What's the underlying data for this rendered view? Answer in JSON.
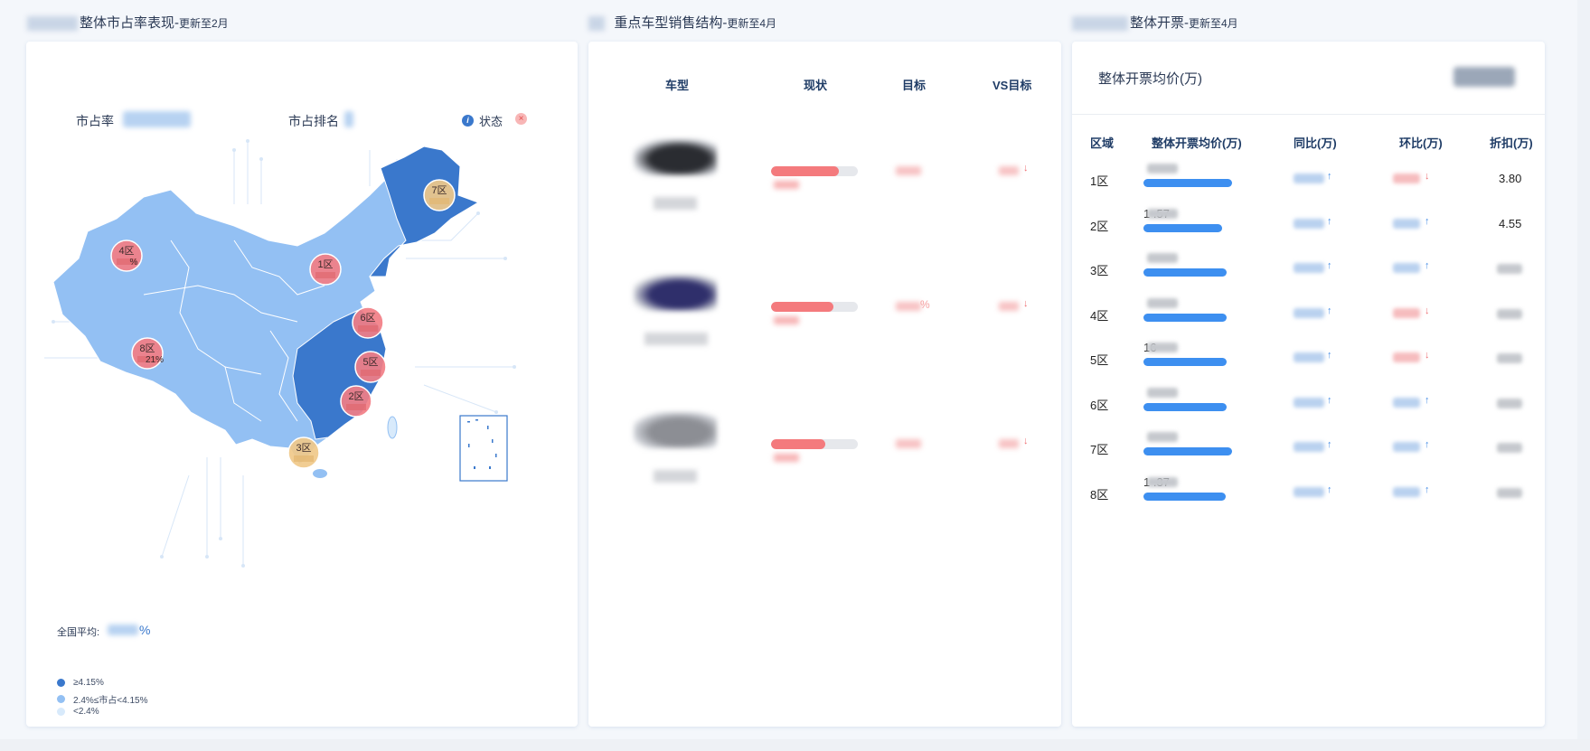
{
  "panels": {
    "map": {
      "title": "整体市占率表现-",
      "subtitle": "更新至2月"
    },
    "models": {
      "title": "重点车型销售结构-",
      "subtitle": "更新至4月"
    },
    "billing": {
      "title": "整体开票-",
      "subtitle": "更新至4月"
    }
  },
  "map": {
    "share_label": "市占率",
    "rank_label": "市占排名",
    "status_label": "状态",
    "national_avg_label": "全国平均:",
    "national_avg_suffix": "%",
    "regions": [
      {
        "name": "1区",
        "level": 0.4
      },
      {
        "name": "2区",
        "level": 0.4
      },
      {
        "name": "3区",
        "level": 0.6
      },
      {
        "name": "4区",
        "level": 0.4
      },
      {
        "name": "5区",
        "level": 0.4
      },
      {
        "name": "6区",
        "level": 0.4
      },
      {
        "name": "7区",
        "level": 0.6
      },
      {
        "name": "8区",
        "level": 0.4
      }
    ],
    "region_value_suffix": {
      "4区": "%",
      "8区": "21%"
    },
    "legend": [
      {
        "label": "≥4.15%",
        "color": "#3a78cc"
      },
      {
        "label": "2.4%≤市占<4.15%",
        "color": "#93c0f3"
      },
      {
        "label": "<2.4%",
        "color": "#d8eafb"
      }
    ]
  },
  "models": {
    "headers": [
      "车型",
      "现状",
      "目标",
      "VS目标"
    ],
    "rows": [
      {
        "progress": 0.78,
        "target_suffix": "",
        "vs_arrow": "↓",
        "car_color": "#2a2c31"
      },
      {
        "progress": 0.72,
        "target_suffix": "%",
        "vs_arrow": "↓",
        "car_color": "#2f2f6b"
      },
      {
        "progress": 0.62,
        "target_suffix": "",
        "vs_arrow": "↓",
        "car_color": "#8c8e94"
      }
    ]
  },
  "billing": {
    "avg_label": "整体开票均价(万)",
    "headers": [
      "区域",
      "整体开票均价(万)",
      "同比(万)",
      "环比(万)",
      "折扣(万)"
    ],
    "rows": [
      {
        "region": "1区",
        "avg_visible": "",
        "bar": 0.89,
        "yoy_arrow": "↑",
        "mom_arrow": "↓",
        "discount_visible": "3.80"
      },
      {
        "region": "2区",
        "avg_visible": "1 .57",
        "bar": 0.79,
        "yoy_arrow": "↑",
        "mom_arrow": "↑",
        "discount_visible": "4.55"
      },
      {
        "region": "3区",
        "avg_visible": "",
        "bar": 0.84,
        "yoy_arrow": "↑",
        "mom_arrow": "↑",
        "discount_visible": ""
      },
      {
        "region": "4区",
        "avg_visible": "",
        "bar": 0.84,
        "yoy_arrow": "↑",
        "mom_arrow": "↓",
        "discount_visible": ""
      },
      {
        "region": "5区",
        "avg_visible": "16",
        "bar": 0.84,
        "yoy_arrow": "↑",
        "mom_arrow": "↓",
        "discount_visible": ""
      },
      {
        "region": "6区",
        "avg_visible": "",
        "bar": 0.84,
        "yoy_arrow": "↑",
        "mom_arrow": "↑",
        "discount_visible": ""
      },
      {
        "region": "7区",
        "avg_visible": "",
        "bar": 0.89,
        "yoy_arrow": "↑",
        "mom_arrow": "↑",
        "discount_visible": ""
      },
      {
        "region": "8区",
        "avg_visible": "1 .37",
        "bar": 0.83,
        "yoy_arrow": "↑",
        "mom_arrow": "↑",
        "discount_visible": ""
      }
    ]
  },
  "colors": {
    "accent_blue": "#3d8ff0",
    "dark_blue": "#3a78cc",
    "light_blue": "#93c0f3",
    "progress_red": "#f47a7d",
    "bubble_red": "#f27e86",
    "bubble_gold": "#f0c98a",
    "up_color": "#4a8fe6",
    "down_color": "#ee6f73"
  },
  "icons": [
    "info-icon",
    "close-icon",
    "arrow-up-icon",
    "arrow-down-icon"
  ]
}
